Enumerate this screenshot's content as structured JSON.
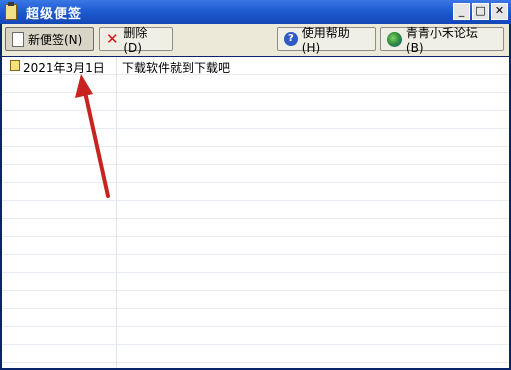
{
  "window": {
    "title": "超级便签"
  },
  "caption_buttons": {
    "minimize": "_",
    "maximize": "□",
    "close": "✕"
  },
  "toolbar": {
    "new_label": "新便签(N)",
    "delete_label": "删除(D)",
    "help_label": "使用帮助(H)",
    "forum_label": "青青小禾论坛(B)"
  },
  "notes": [
    {
      "date": "2021年3月1日",
      "text": "下载软件就到下载吧"
    }
  ],
  "icons": {
    "new": "document-icon",
    "delete": "delete-x-icon",
    "help": "help-icon",
    "forum": "globe-icon",
    "note": "note-icon"
  },
  "colors": {
    "accent": "#1f5bd1",
    "arrow": "#c8231e"
  }
}
